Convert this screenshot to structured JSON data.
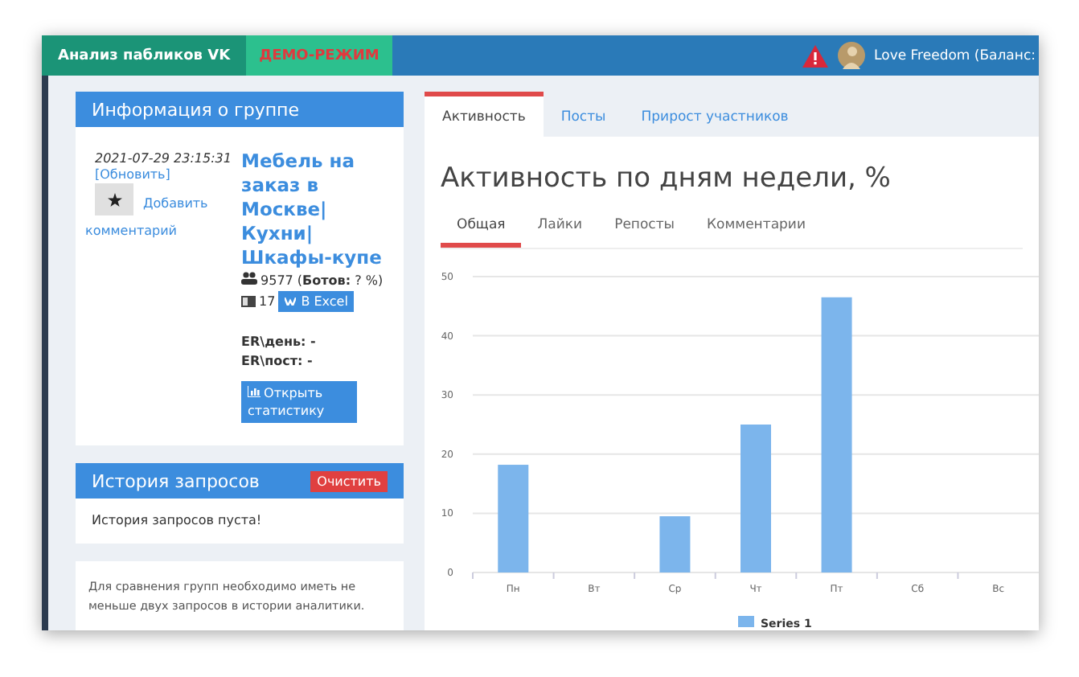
{
  "top_bar": {
    "brand": "Анализ пабликов VK",
    "mode": "ДЕМО-РЕЖИМ",
    "user": "Love Freedom (Баланс:"
  },
  "group_panel": {
    "title": "Информация о группе",
    "date": "2021-07-29 23:15:31",
    "refresh_link": "[Обновить]",
    "comment_link": "Добавить комментарий",
    "group_name": "Мебель на заказ в Москве| Кухни| Шкафы-купе",
    "members": "9577 (**Ботов:** ? %)",
    "posts": "17",
    "excel_button": "В Excel",
    "er_day": "ER\\день: -",
    "er_post": "ER\\пост: -",
    "stats_button": "Открыть статистику"
  },
  "history_panel": {
    "title": "История запросов",
    "clear_button": "Очистить",
    "empty_text": "История запросов пуста!"
  },
  "compare_note": "Для сравнения групп необходимо иметь не меньше двух запросов в истории аналитики.",
  "tabs": [
    {
      "label": "Активность",
      "selected": true
    },
    {
      "label": "Посты",
      "selected": false
    },
    {
      "label": "Прирост участников",
      "selected": false
    }
  ],
  "chart_title": "Активность по дням недели, %",
  "sub_tabs": [
    {
      "label": "Общая",
      "selected": true
    },
    {
      "label": "Лайки",
      "selected": false
    },
    {
      "label": "Репосты",
      "selected": false
    },
    {
      "label": "Комментарии",
      "selected": false
    }
  ],
  "chart_data": {
    "type": "bar",
    "grid": true,
    "categories": [
      "Пн",
      "Вт",
      "Ср",
      "Чт",
      "Пт",
      "Сб",
      "Вс"
    ],
    "ylim": [
      0,
      50
    ],
    "yticks": [
      0,
      10,
      20,
      30,
      40,
      50
    ],
    "series": [
      {
        "name": "Series 1",
        "color": "#7cb5ec",
        "values": [
          18.2,
          0,
          9.5,
          25,
          46.5,
          0,
          0
        ]
      }
    ]
  }
}
